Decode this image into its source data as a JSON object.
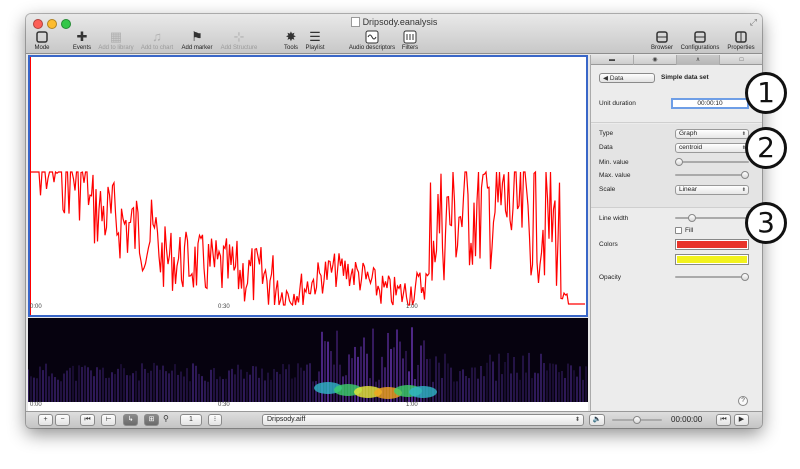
{
  "window": {
    "title": "Dripsody.eanalysis",
    "resize_glyph": "⤢"
  },
  "toolbar": {
    "mode": "Mode",
    "events": "Events",
    "add_to_library": "Add to library",
    "add_to_chart": "Add to chart",
    "add_marker": "Add marker",
    "add_structure": "Add Structure",
    "tools": "Tools",
    "playlist": "Playlist",
    "audio_descriptors": "Audio descriptors",
    "filters": "Filters",
    "browser": "Browser",
    "configurations": "Configurations",
    "properties": "Properties"
  },
  "timeline": {
    "ticks": [
      "0:00",
      "0:30",
      "1:00"
    ]
  },
  "panel": {
    "back_button": "Data",
    "header": "Simple data set",
    "unit_duration_label": "Unit duration",
    "unit_duration_value": "00:00:10",
    "type_label": "Type",
    "type_value": "Graph",
    "data_label": "Data",
    "data_value": "centroid",
    "min_label": "Min. value",
    "max_label": "Max. value",
    "scale_label": "Scale",
    "scale_value": "Linear",
    "line_width_label": "Line width",
    "fill_label": "Fill",
    "colors_label": "Colors",
    "opacity_label": "Opacity",
    "help": "?",
    "min_level": 0.0,
    "max_level": 1.0,
    "line_width_level": 0.2,
    "opacity_level": 1.0,
    "color1": "#e8332a",
    "color2": "#f2f21c"
  },
  "bottombar": {
    "plus": "+",
    "minus": "−",
    "zoom_value": "1",
    "file": "Dripsody.aiff",
    "time": "00:00:00",
    "volume_level": 0.5
  },
  "annotations": [
    "1",
    "2",
    "3"
  ],
  "colors": {
    "graph_line": "#ff0000",
    "selection_border": "#3a67c8"
  }
}
